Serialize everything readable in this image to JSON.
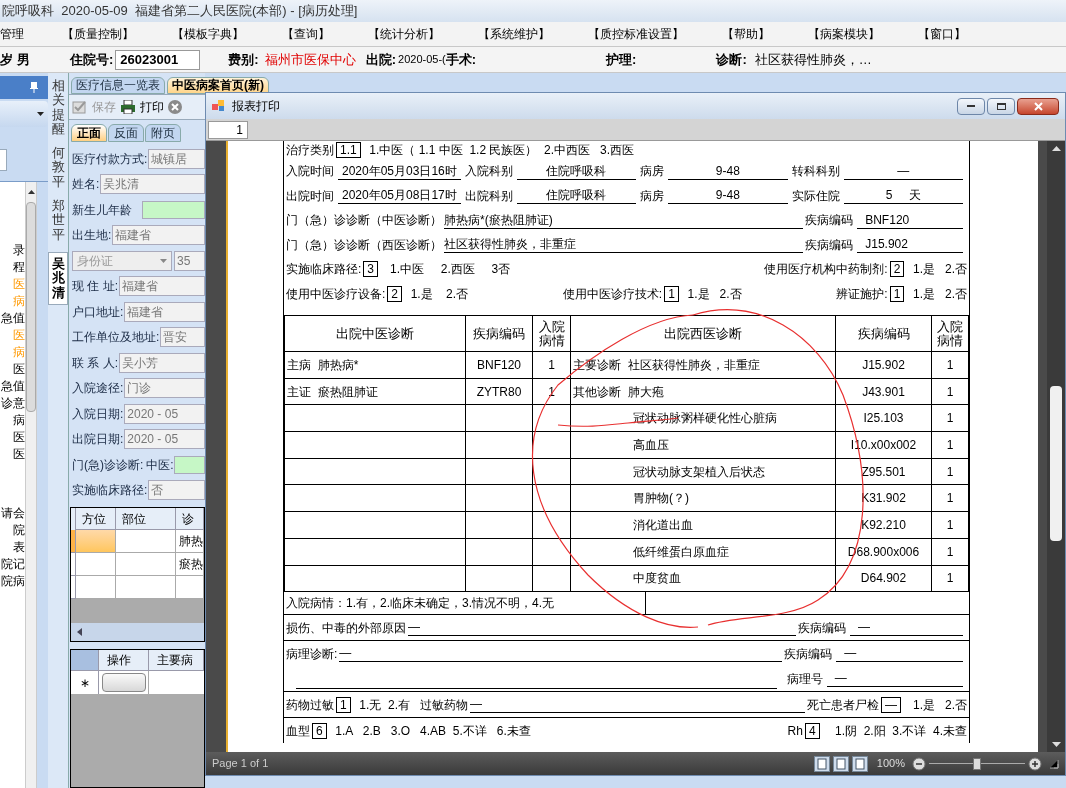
{
  "app_title": "院呼吸科  2020-05-09  福建省第二人民医院(本部) - [病历处理]",
  "menu": [
    "管理",
    "【质量控制】",
    "【模板字典】",
    "【查询】",
    "【统计分析】",
    "【系统维护】",
    "【质控标准设置】",
    "【帮助】",
    "【病案模块】",
    "【窗口】"
  ],
  "patient_bar": {
    "age_sex": "岁 男",
    "admission_no_label": "住院号:",
    "admission_no": "26023001",
    "fee_label": "费别:",
    "fee": "福州市医保中心",
    "discharge_label": "出院:",
    "discharge": "2020-05-(",
    "surgery_label": "手术:",
    "nursing_label": "护理:",
    "diagnosis_label": "诊断:",
    "diagnosis": "社区获得性肺炎，…"
  },
  "left_list": [
    {
      "text": "录",
      "highlighted": false
    },
    {
      "text": "程",
      "highlighted": false
    },
    {
      "text": "医",
      "highlighted": true
    },
    {
      "text": "病",
      "highlighted": true
    },
    {
      "text": "急值",
      "highlighted": false
    },
    {
      "text": "医",
      "highlighted": true
    },
    {
      "text": "病",
      "highlighted": true
    },
    {
      "text": "医",
      "highlighted": false
    },
    {
      "text": "急值",
      "highlighted": false
    },
    {
      "text": "诊意",
      "highlighted": false
    },
    {
      "text": "病",
      "highlighted": false
    },
    {
      "text": "医",
      "highlighted": false
    },
    {
      "text": "医",
      "highlighted": false
    },
    {
      "text": "请会",
      "highlighted": false
    },
    {
      "text": "院",
      "highlighted": false
    },
    {
      "text": "表",
      "highlighted": false
    },
    {
      "text": "院记",
      "highlighted": false
    },
    {
      "text": "院病",
      "highlighted": false
    }
  ],
  "vertical_tabs": [
    {
      "label": "相关提醒",
      "selected": false
    },
    {
      "label": "何敦平",
      "selected": false
    },
    {
      "label": "郑世平",
      "selected": false
    },
    {
      "label": "吴兆清",
      "selected": true
    }
  ],
  "form": {
    "tabs": [
      {
        "label": "医疗信息一览表",
        "selected": false
      },
      {
        "label": "中医病案首页(新)",
        "selected": true
      }
    ],
    "toolbar": [
      {
        "label": "保存",
        "kind": "save",
        "disabled": true
      },
      {
        "label": "打印",
        "kind": "print",
        "disabled": false
      }
    ],
    "subtabs": [
      {
        "label": "正面",
        "selected": true
      },
      {
        "label": "反面",
        "selected": false
      },
      {
        "label": "附页",
        "selected": false
      }
    ],
    "fields": [
      {
        "kind": "text",
        "label": "医疗付款方式:",
        "value": "城镇居"
      },
      {
        "kind": "text",
        "label": "姓名:",
        "value": "吴兆清"
      },
      {
        "kind": "highlight",
        "label": "新生儿年龄"
      },
      {
        "kind": "text",
        "label": "出生地:",
        "value": "福建省"
      },
      {
        "kind": "id",
        "value": "身份证",
        "value2": "35"
      },
      {
        "kind": "text",
        "label": "现 住 址:",
        "value": "福建省"
      },
      {
        "kind": "text",
        "label": "户口地址:",
        "value": "福建省"
      },
      {
        "kind": "text",
        "label": "工作单位及地址:",
        "value": "晋安"
      },
      {
        "kind": "text",
        "label": "联 系 人:",
        "value": "吴小芳"
      },
      {
        "kind": "text",
        "label": "入院途径:",
        "value": "门诊"
      },
      {
        "kind": "text",
        "label": "入院日期:",
        "value": "2020 - 05"
      },
      {
        "kind": "text",
        "label": "出院日期:",
        "value": "2020 - 05"
      },
      {
        "kind": "dual",
        "label": "门(急)诊诊断:",
        "sublabel": "中医:"
      },
      {
        "kind": "text",
        "label": "实施临床路径:",
        "value": "否"
      }
    ],
    "grid1": {
      "columns": [
        "方位",
        "部位",
        "诊"
      ],
      "rows": [
        {
          "cells": [
            "",
            "",
            "肺热"
          ],
          "selected": true
        },
        {
          "cells": [
            "",
            "",
            "瘀热"
          ],
          "selected": false
        },
        {
          "cells": [
            "",
            "",
            ""
          ],
          "selected": false
        }
      ]
    },
    "grid2": {
      "columns": [
        "操作",
        "主要病"
      ],
      "new_row_marker": "∗"
    }
  },
  "report": {
    "title": "报表打印",
    "page_field": "1",
    "top_rows": [
      [
        {
          "kind": "label",
          "text": "治疗类别"
        },
        {
          "kind": "box",
          "text": "1.1"
        },
        {
          "kind": "text",
          "text": "  1.中医（ 1.1 中医  1.2 民族医）  2.中西医   3.西医"
        }
      ],
      [
        {
          "kind": "label",
          "text": "入院时间"
        },
        {
          "kind": "field",
          "text": "2020年05月03日16时"
        },
        {
          "kind": "label",
          "text": "入院科别"
        },
        {
          "kind": "field",
          "text": "住院呼吸科"
        },
        {
          "kind": "label",
          "text": "病房"
        },
        {
          "kind": "field",
          "text": "9-48"
        },
        {
          "kind": "label",
          "text": "转科科别"
        },
        {
          "kind": "field",
          "text": "—"
        }
      ],
      [
        {
          "kind": "label",
          "text": "出院时间"
        },
        {
          "kind": "field",
          "text": "2020年05月08日17时"
        },
        {
          "kind": "label",
          "text": "出院科别"
        },
        {
          "kind": "field",
          "text": "住院呼吸科"
        },
        {
          "kind": "label",
          "text": "病房"
        },
        {
          "kind": "field",
          "text": "9-48"
        },
        {
          "kind": "label",
          "text": "实际住院"
        },
        {
          "kind": "field",
          "text": "5     天"
        }
      ],
      [
        {
          "kind": "label",
          "text": "门（急）诊诊断（中医诊断）"
        },
        {
          "kind": "wide_field",
          "text": "肺热病*(瘀热阻肺证)"
        },
        {
          "kind": "label",
          "text": "疾病编码"
        },
        {
          "kind": "field_left",
          "text": "BNF120"
        }
      ],
      [
        {
          "kind": "label",
          "text": "门（急）诊诊断（西医诊断）"
        },
        {
          "kind": "wide_field",
          "text": "社区获得性肺炎，非重症"
        },
        {
          "kind": "label",
          "text": "疾病编码"
        },
        {
          "kind": "field_left",
          "text": "J15.902"
        }
      ],
      [
        {
          "kind": "label",
          "text": "实施临床路径:"
        },
        {
          "kind": "box",
          "text": "3"
        },
        {
          "kind": "text",
          "text": "   1.中医     2.西医     3否"
        },
        {
          "kind": "gap"
        },
        {
          "kind": "label",
          "text": "使用医疗机构中药制剂:"
        },
        {
          "kind": "box",
          "text": "2"
        },
        {
          "kind": "text",
          "text": "  1.是   2.否"
        }
      ],
      [
        {
          "kind": "label",
          "text": "使用中医诊疗设备:"
        },
        {
          "kind": "box",
          "text": "2"
        },
        {
          "kind": "text",
          "text": "  1.是    2.否"
        },
        {
          "kind": "gap"
        },
        {
          "kind": "label",
          "text": "使用中医诊疗技术:"
        },
        {
          "kind": "box",
          "text": "1"
        },
        {
          "kind": "text",
          "text": "  1.是   2.否"
        },
        {
          "kind": "gap"
        },
        {
          "kind": "label",
          "text": "辨证施护:"
        },
        {
          "kind": "box",
          "text": "1"
        },
        {
          "kind": "text",
          "text": "  1.是   2.否"
        }
      ]
    ],
    "table": {
      "columns": [
        "出院中医诊断",
        "疾病编码",
        "入院病情",
        "出院西医诊断",
        "疾病编码",
        "入院病情"
      ],
      "rows": [
        {
          "tcm": "主病  肺热病*",
          "tcm_code": "BNF120",
          "tcm_cond": "1",
          "kind": "primary",
          "wm": "主要诊断  社区获得性肺炎，非重症",
          "wm_code": "J15.902",
          "wm_cond": "1"
        },
        {
          "tcm": "主证  瘀热阻肺证",
          "tcm_code": "ZYTR80",
          "tcm_cond": "1",
          "kind": "primary",
          "wm": "其他诊断  肺大疱",
          "wm_code": "J43.901",
          "wm_cond": "1"
        },
        {
          "kind": "continued",
          "wm": "冠状动脉粥样硬化性心脏病",
          "wm_code": "I25.103",
          "wm_cond": "1"
        },
        {
          "kind": "continued",
          "wm": "高血压",
          "wm_code": "I10.x00x002",
          "wm_cond": "1"
        },
        {
          "kind": "continued",
          "wm": "冠状动脉支架植入后状态",
          "wm_code": "Z95.501",
          "wm_cond": "1"
        },
        {
          "kind": "continued",
          "wm": "胃肿物(？)",
          "wm_code": "K31.902",
          "wm_cond": "1"
        },
        {
          "kind": "continued",
          "wm": "消化道出血",
          "wm_code": "K92.210",
          "wm_cond": "1"
        },
        {
          "kind": "continued",
          "wm": "低纤维蛋白原血症",
          "wm_code": "D68.900x006",
          "wm_cond": "1"
        },
        {
          "kind": "continued",
          "wm": "中度贫血",
          "wm_code": "D64.902",
          "wm_cond": "1"
        }
      ]
    },
    "footer_rows": [
      [
        [
          {
            "kind": "text",
            "text": "入院病情：1.有，2.临床未确定，3.情况不明，4.无"
          },
          {
            "kind": "divider"
          }
        ]
      ],
      [
        [
          {
            "kind": "label",
            "text": "损伤、中毒的外部原因"
          },
          {
            "kind": "wide_field",
            "text": "—"
          },
          {
            "kind": "label",
            "text": "疾病编码"
          },
          {
            "kind": "field_left",
            "text": "—"
          }
        ]
      ],
      [
        [
          {
            "kind": "label",
            "text": "病理诊断:"
          },
          {
            "kind": "wide_field",
            "text": "—"
          },
          {
            "kind": "label",
            "text": "疾病编码"
          },
          {
            "kind": "field_left",
            "text": "—"
          }
        ],
        [
          {
            "kind": "blank_line"
          },
          {
            "kind": "label",
            "text": "病理号"
          },
          {
            "kind": "field_left",
            "text": "—"
          }
        ]
      ],
      [
        [
          {
            "kind": "label",
            "text": "药物过敏"
          },
          {
            "kind": "box",
            "text": "1"
          },
          {
            "kind": "text",
            "text": "  1.无  2.有   过敏药物"
          },
          {
            "kind": "wide_field",
            "text": "—"
          },
          {
            "kind": "label",
            "text": "死亡患者尸检"
          },
          {
            "kind": "box",
            "text": "—"
          },
          {
            "kind": "text",
            "text": "   1.是   2.否"
          }
        ]
      ],
      [
        [
          {
            "kind": "label",
            "text": "血型"
          },
          {
            "kind": "box",
            "text": "6"
          },
          {
            "kind": "text",
            "text": "  1.A   2.B   3.O   4.AB  5.不详   6.未查"
          },
          {
            "kind": "gap"
          },
          {
            "kind": "label",
            "text": "Rh"
          },
          {
            "kind": "box",
            "text": "4"
          },
          {
            "kind": "text",
            "text": "    1.阴  2.阳  3.不详  4.未查"
          }
        ]
      ]
    ],
    "status": "Page 1 of 1",
    "zoom": "100%",
    "zoom_slider": {
      "level": 0.5
    }
  }
}
